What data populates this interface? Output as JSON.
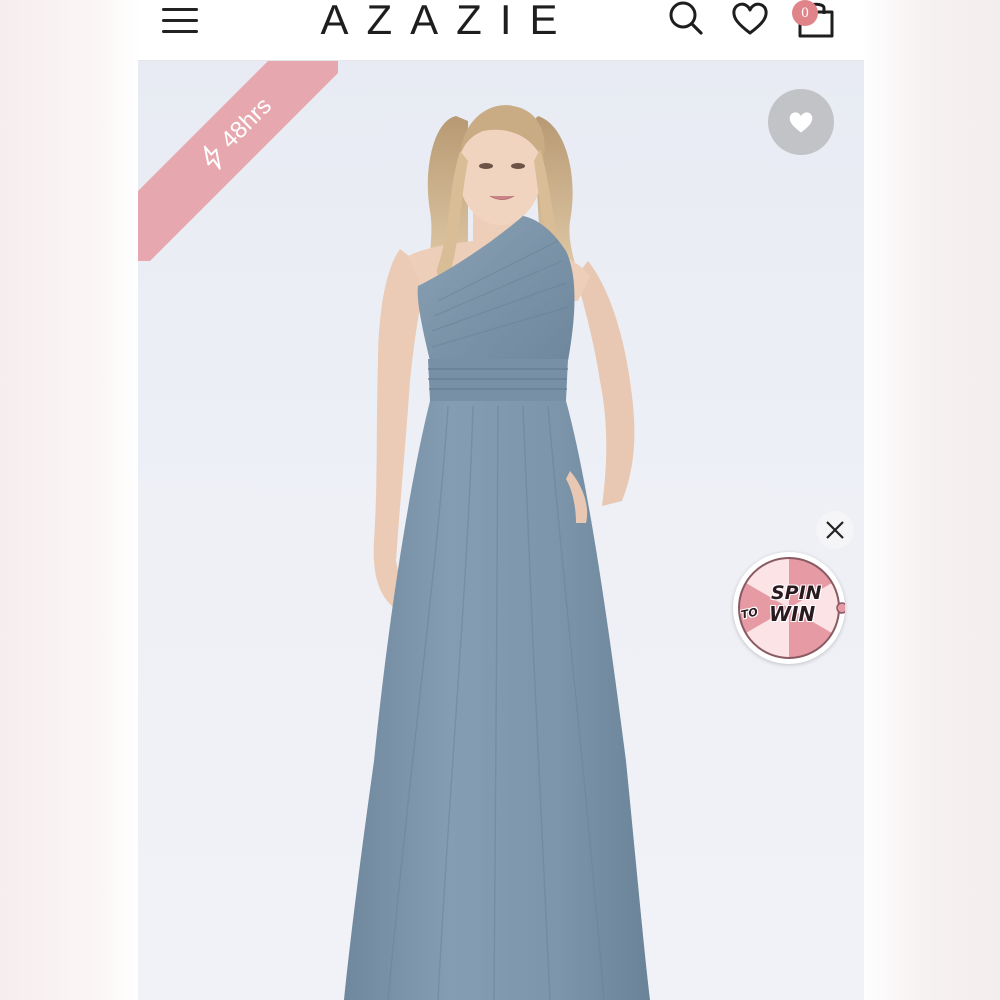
{
  "header": {
    "brand": "AZAZIE",
    "menu_icon": "hamburger-menu-icon",
    "search_icon": "search-icon",
    "wishlist_icon": "heart-outline-icon",
    "cart_icon": "shopping-bag-icon",
    "cart_count": "0"
  },
  "product": {
    "shipping_badge": "48hrs",
    "shipping_badge_icon": "lightning-bolt-icon",
    "favorite_icon": "heart-filled-icon",
    "dress_color": "#7f98ad",
    "badge_color": "#e7a7ae"
  },
  "promo": {
    "spin_word": "SPIN",
    "to_word": "TO",
    "win_word": "WIN",
    "close_icon": "close-icon"
  }
}
